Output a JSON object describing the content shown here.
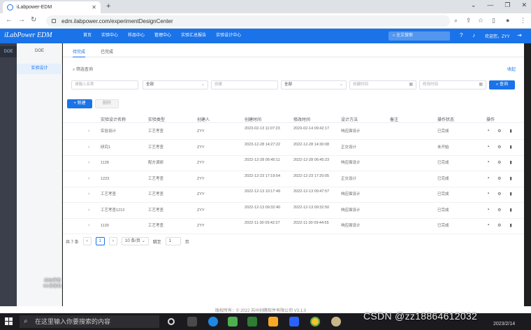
{
  "browser": {
    "tab_title": "iLabpower-EDM",
    "url": "edm.ilabpower.com/experimentDesignCenter"
  },
  "header": {
    "logo": "iLabPower EDM",
    "nav": [
      "首页",
      "实验中心",
      "样品中心",
      "管理中心",
      "实验汇总报告",
      "实验设计中心"
    ],
    "search_placeholder": "全文搜索",
    "user": "欢迎您，ZYY"
  },
  "sidebar": {
    "module": "DOE",
    "title": "DOE",
    "item": "实验设计"
  },
  "tabs": [
    "待完成",
    "已完成"
  ],
  "filter": {
    "label": "筛选查询",
    "collapse": "收起",
    "name_placeholder": "请输入名称",
    "type_value": "全部",
    "creator_placeholder": "创建",
    "method_value": "全部",
    "create_time_placeholder": "创建时间",
    "modify_time_placeholder": "修改时间",
    "query_button": "查询"
  },
  "toolbar": {
    "new_button": "+ 新建",
    "delete_button": "删除"
  },
  "table": {
    "columns": [
      "实验设计名称",
      "实验类型",
      "创建人",
      "创建时间",
      "修改时间",
      "设计方法",
      "备注",
      "操作状态",
      "操作"
    ],
    "rows": [
      {
        "name": "实验设计",
        "type": "工艺考查",
        "creator": "ZYY",
        "created": "2023-02-13 11:07:23",
        "modified": "2023-02-14 09:42:17",
        "method": "响应面设计",
        "note": "",
        "status": "已完成"
      },
      {
        "name": "研究1",
        "type": "工艺考查",
        "creator": "ZYY",
        "created": "2023-12-28 14:27:22",
        "modified": "2022-12-28 14:30:08",
        "method": "正交设计",
        "note": "",
        "status": "未开始"
      },
      {
        "name": "1128",
        "type": "配方调研",
        "creator": "ZYY",
        "created": "2022-12-28 06:45:11",
        "modified": "2022-12-28 06:45:23",
        "method": "响应面设计",
        "note": "",
        "status": "已完成"
      },
      {
        "name": "1223",
        "type": "工艺考查",
        "creator": "ZYY",
        "created": "2022-12-23 17:19:54",
        "modified": "2022-12-23 17:20:05",
        "method": "正交设计",
        "note": "",
        "status": "已完成"
      },
      {
        "name": "工艺考查",
        "type": "工艺考查",
        "creator": "ZYY",
        "created": "2022-12-13 10:17:49",
        "modified": "2022-12-13 09:47:57",
        "method": "响应面设计",
        "note": "",
        "status": "已完成"
      },
      {
        "name": "工艺考查1213",
        "type": "工艺考查",
        "creator": "ZYY",
        "created": "2022-12-13 09:32:40",
        "modified": "2022-12-13 09:32:50",
        "method": "响应面设计",
        "note": "",
        "status": "已完成"
      },
      {
        "name": "1130",
        "type": "工艺考查",
        "creator": "ZYY",
        "created": "2022-11-30 09:42:27",
        "modified": "2022-11-30 09:44:55",
        "method": "响应面设计",
        "note": "",
        "status": "已完成"
      }
    ]
  },
  "pager": {
    "total": "共 7 条",
    "current": "1",
    "page_size": "10 条/页",
    "goto_label": "跳至",
    "goto_value": "1",
    "page_suffix": "页"
  },
  "footer": "版权所有：© 2022 苏州创腾软件有限公司 V3.1.0",
  "overlay": {
    "line1": "初始界面",
    "line2": "KK录像机",
    "csdn": "CSDN @zz18864612032"
  },
  "taskbar": {
    "search_placeholder": "在这里输入你要搜索的内容",
    "date": "2023/2/14"
  },
  "colors": {
    "accent": "#1a73e8"
  }
}
